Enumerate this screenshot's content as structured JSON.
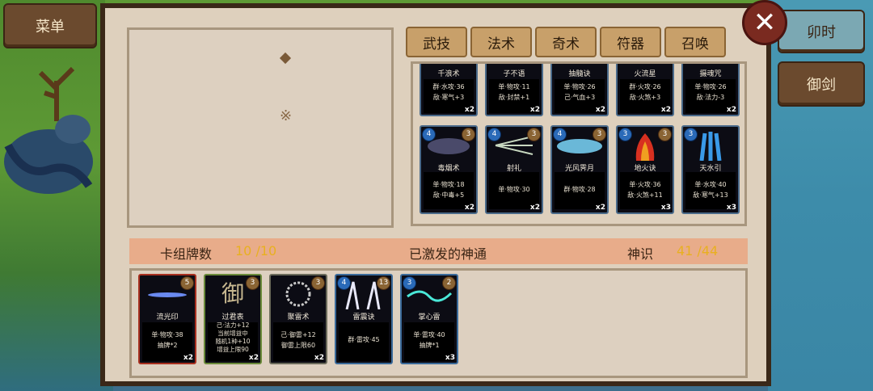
{
  "buttons": {
    "menu": "菜单",
    "right_top": "卯时",
    "right_bottom": "御剑",
    "close": "✕"
  },
  "tabs": [
    "武技",
    "法术",
    "奇术",
    "符器",
    "召唤"
  ],
  "preview": {
    "mark": "※"
  },
  "library_row1": [
    {
      "name": "千浪术",
      "line1": "群·水攻·36",
      "line2": "敌·寒气+3",
      "qty": "x2"
    },
    {
      "name": "子不语",
      "line1": "单·物攻·11",
      "line2": "敌·封禁+1",
      "qty": "x2"
    },
    {
      "name": "抽髓诀",
      "line1": "单·物攻·26",
      "line2": "己·气血+3",
      "qty": "x2"
    },
    {
      "name": "火流星",
      "line1": "群·火攻·26",
      "line2": "敌·火煞+3",
      "qty": "x2"
    },
    {
      "name": "摄魂咒",
      "line1": "单·物攻·26",
      "line2": "敌·法力-3",
      "qty": "x2"
    }
  ],
  "library_row2": [
    {
      "name": "毒烟术",
      "cost_l": "4",
      "cost_r": "3",
      "line1": "单·物攻·18",
      "line2": "敌·中毒+5",
      "qty": "x2"
    },
    {
      "name": "射礼",
      "cost_l": "4",
      "cost_r": "3",
      "line1": "单·物攻·30",
      "line2": "",
      "qty": "x2"
    },
    {
      "name": "光风霁月",
      "cost_l": "4",
      "cost_r": "3",
      "line1": "群·物攻·28",
      "line2": "",
      "qty": "x2"
    },
    {
      "name": "地火诀",
      "cost_l": "3",
      "cost_r": "3",
      "line1": "单·火攻·36",
      "line2": "敌·火煞+11",
      "qty": "x3"
    },
    {
      "name": "天水引",
      "cost_l": "3",
      "cost_r": "",
      "line1": "单·水攻·40",
      "line2": "敌·寒气+13",
      "qty": "x3"
    }
  ],
  "status": {
    "deck_label": "卡组牌数",
    "deck_value": "10 /10",
    "title": "已激发的神通",
    "sense_label": "神识",
    "sense_value": "41 /44"
  },
  "deck": [
    {
      "name": "流光印",
      "cost_l": "",
      "cost_r": "5",
      "line1": "单·物攻·38",
      "line2": "抽牌*2",
      "line3": "",
      "line4": "",
      "qty": "x2"
    },
    {
      "name": "过君表",
      "cost_l": "",
      "cost_r": "3",
      "line1": "己·法力+12",
      "line2": "当前增益中",
      "line3": "随机1种+10",
      "line4": "增益上限90",
      "qty": "x2",
      "glyph": "御"
    },
    {
      "name": "聚雷术",
      "cost_l": "",
      "cost_r": "3",
      "line1": "己·御雷+12",
      "line2": "御雷上限60",
      "line3": "",
      "line4": "",
      "qty": "x2"
    },
    {
      "name": "雷震诀",
      "cost_l": "4",
      "cost_r": "13",
      "line1": "群·雷攻·45",
      "line2": "",
      "line3": "",
      "line4": "",
      "qty": ""
    },
    {
      "name": "掌心雷",
      "cost_l": "3",
      "cost_r": "2",
      "line1": "单·雷攻·40",
      "line2": "抽牌*1",
      "line3": "",
      "line4": "",
      "qty": "x3"
    }
  ],
  "colors": {
    "panel": "#ded0bd",
    "status_bar": "#e8ac8a",
    "accent_yellow": "#e8b020"
  }
}
